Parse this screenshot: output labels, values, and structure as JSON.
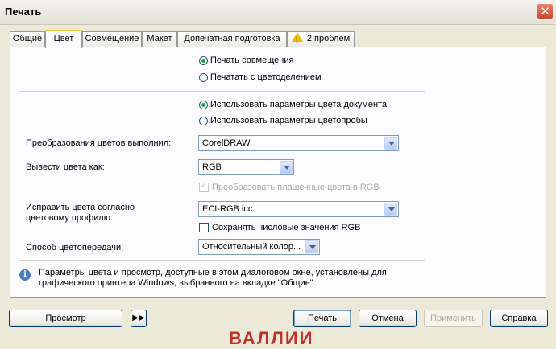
{
  "window": {
    "title": "Печать"
  },
  "tabs": [
    {
      "label": "Общие"
    },
    {
      "label": "Цвет"
    },
    {
      "label": "Совмещение"
    },
    {
      "label": "Макет"
    },
    {
      "label": "Допечатная подготовка"
    },
    {
      "label": "2 проблем"
    }
  ],
  "output_mode": {
    "composite": "Печать совмещения",
    "separations": "Печатать с цветоделением"
  },
  "color_settings": {
    "document": "Использовать параметры цвета документа",
    "proof": "Использовать параметры цветопробы"
  },
  "conversion": {
    "label": "Преобразования цветов выполнил:",
    "value": "CorelDRAW"
  },
  "output_as": {
    "label": "Вывести цвета как:",
    "value": "RGB"
  },
  "convert_spot": {
    "label": "Преобразовать плашечные цвета в RGB"
  },
  "profile": {
    "label_line1": "Исправить цвета согласно",
    "label_line2": "цветовому профилю:",
    "value": "ECI-RGB.icc"
  },
  "preserve_rgb": {
    "label": "Сохранять числовые значения RGB"
  },
  "rendering": {
    "label": "Способ цветопередачи:",
    "value": "Относительный колор..."
  },
  "info": {
    "line1": "Параметры цвета и просмотр, доступные в этом диалоговом окне, установлены для",
    "line2": "графического принтера Windows, выбранного на вкладке \"Общие\"."
  },
  "buttons": {
    "preview": "Просмотр",
    "print": "Печать",
    "cancel": "Отмена",
    "apply": "Применить",
    "help": "Справка"
  },
  "background_text": "ВАЛЛИИ"
}
